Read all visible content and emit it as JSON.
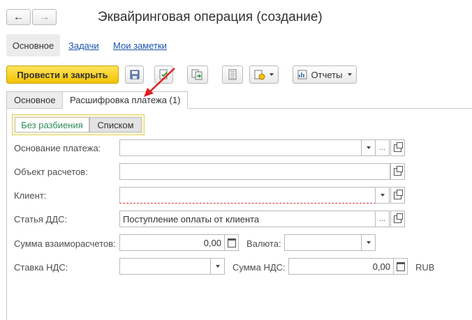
{
  "window": {
    "title": "Эквайринговая операция (создание)"
  },
  "nav": {
    "back_icon": "←",
    "forward_icon": "→"
  },
  "top_tabs": [
    {
      "label": "Основное"
    },
    {
      "label": "Задачи"
    },
    {
      "label": "Мои заметки"
    }
  ],
  "toolbar": {
    "post_close_label": "Провести и закрыть",
    "reports_label": "Отчеты"
  },
  "tabs": [
    {
      "label": "Основное"
    },
    {
      "label": "Расшифровка платежа (1)"
    }
  ],
  "segment": {
    "option1": "Без разбиения",
    "option2": "Списком"
  },
  "form": {
    "basis_label": "Основание платежа:",
    "basis_value": "",
    "object_label": "Объект расчетов:",
    "object_value": "",
    "client_label": "Клиент:",
    "client_value": "",
    "dds_label": "Статья ДДС:",
    "dds_value": "Поступление оплаты от клиента",
    "sum_label": "Сумма взаиморасчетов:",
    "sum_value": "0,00",
    "currency_label": "Валюта:",
    "currency_value": "",
    "vat_rate_label": "Ставка НДС:",
    "vat_rate_value": "",
    "vat_sum_label": "Сумма НДС:",
    "vat_sum_value": "0,00",
    "vat_currency": "RUB"
  },
  "colors": {
    "accent": "#f2c300",
    "link": "#1b57a8",
    "segment_active": "#2e8b57",
    "annotation_arrow": "#e02020"
  }
}
